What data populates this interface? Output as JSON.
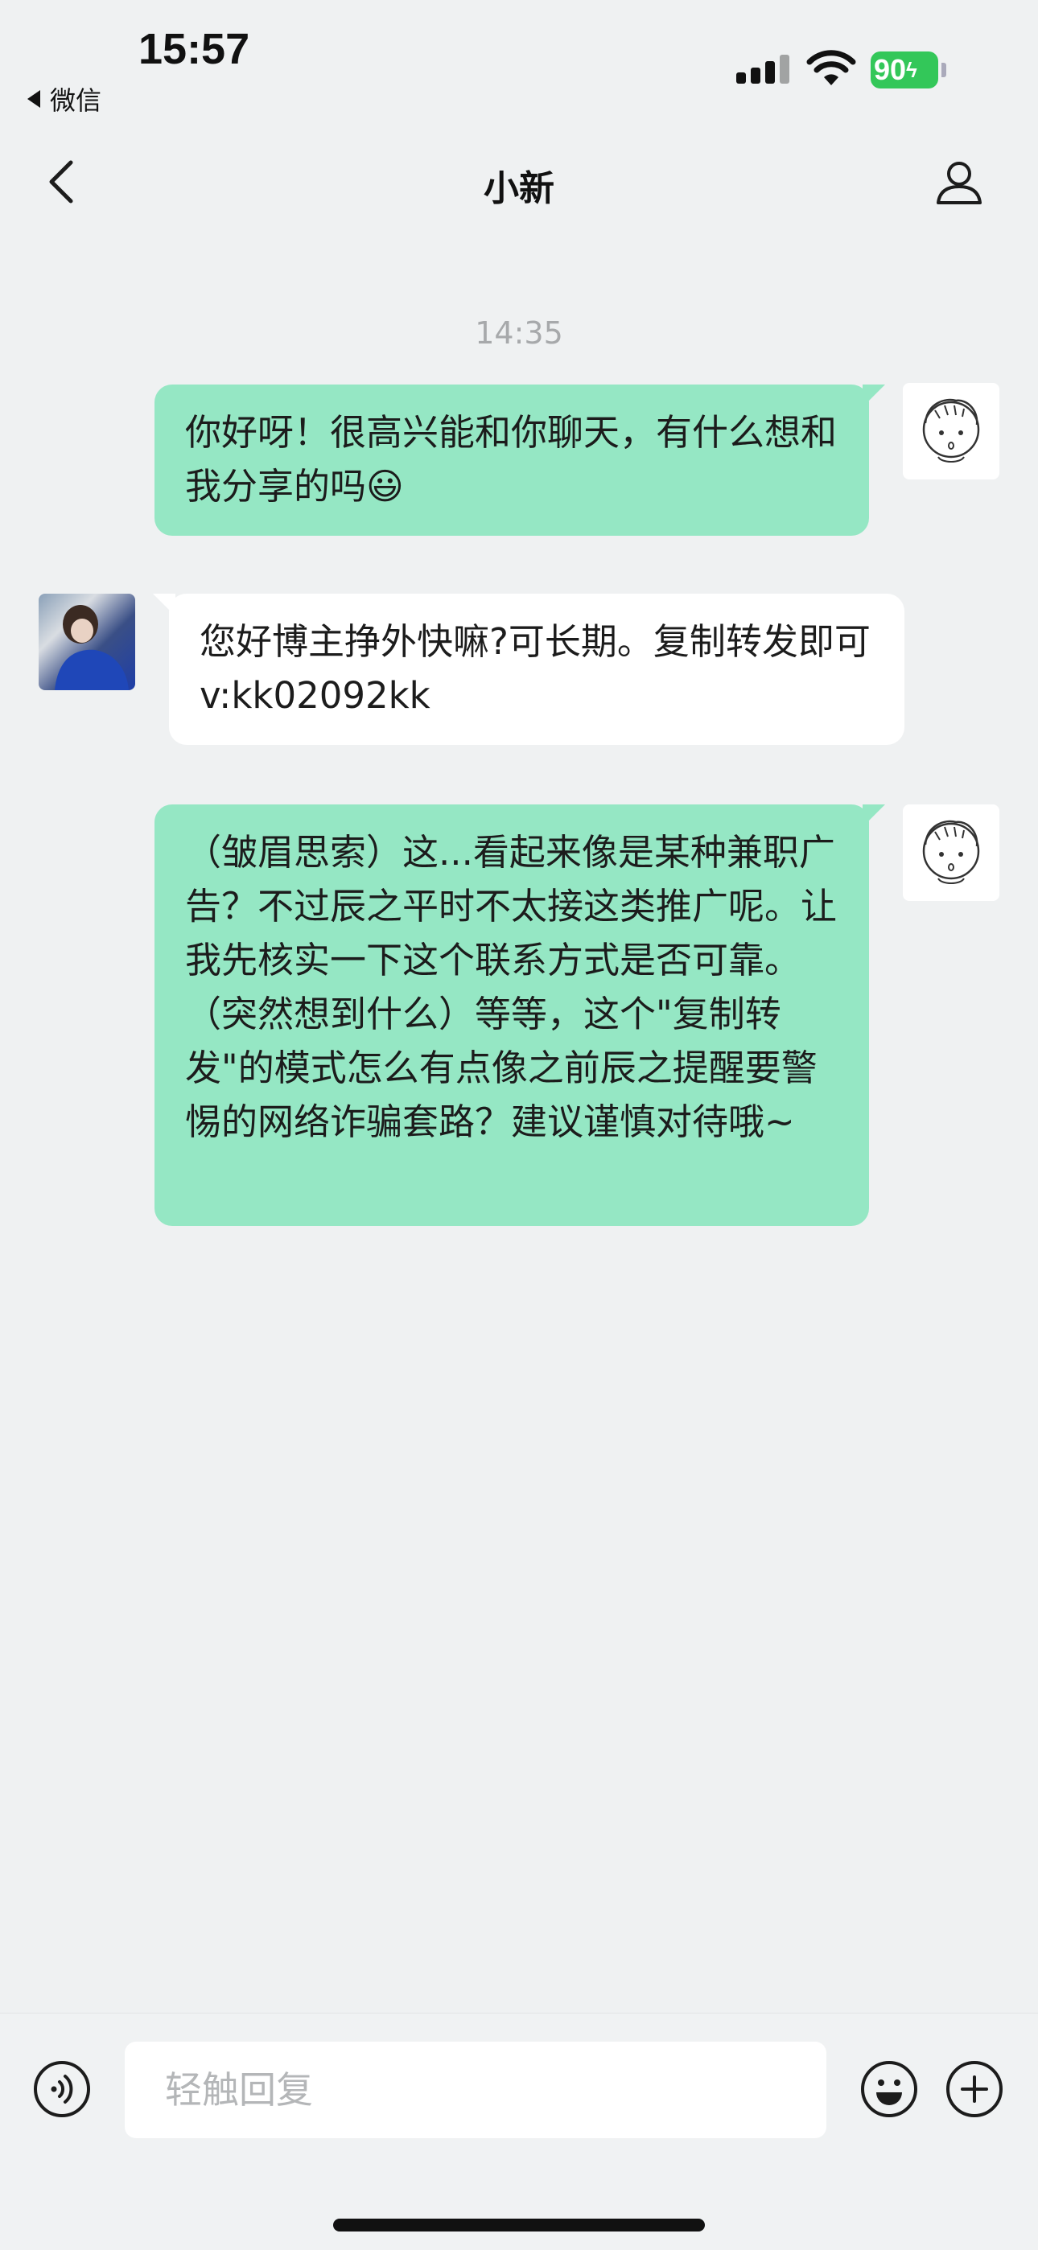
{
  "status_bar": {
    "time": "15:57",
    "back_app": "微信",
    "battery": "90"
  },
  "header": {
    "title": "小新"
  },
  "chat": {
    "timestamp": "14:35",
    "messages": [
      {
        "sender": "bot",
        "text": "你好呀！很高兴能和你聊天，有什么想和我分享的吗😃"
      },
      {
        "sender": "user",
        "text": "您好博主挣外快嘛?可长期。复制转发即可v:kk02092kk"
      },
      {
        "sender": "bot",
        "text": "（皱眉思索）这...看起来像是某种兼职广告？不过辰之平时不太接这类推广呢。让我先核实一下这个联系方式是否可靠。（突然想到什么）等等，这个\"复制转发\"的模式怎么有点像之前辰之提醒要警惕的网络诈骗套路？建议谨慎对待哦~"
      }
    ]
  },
  "input": {
    "placeholder": "轻触回复"
  },
  "colors": {
    "bot_bubble": "#95e7c4",
    "user_bubble": "#ffffff",
    "background": "#eff1f2",
    "battery": "#33c759"
  },
  "icons": {
    "back": "chevron-left-icon",
    "profile": "person-icon",
    "voice": "voice-icon",
    "emoji": "smiley-icon",
    "plus": "plus-circle-icon"
  }
}
